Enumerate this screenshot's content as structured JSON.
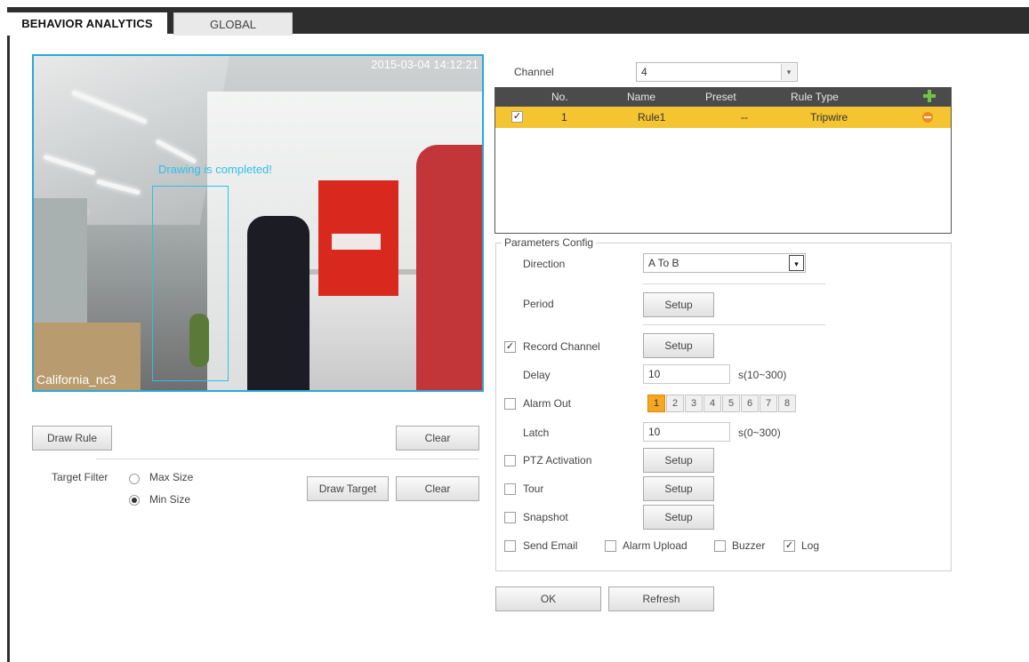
{
  "tabs": [
    {
      "label": "BEHAVIOR ANALYTICS",
      "active": true
    },
    {
      "label": "GLOBAL",
      "active": false
    }
  ],
  "video": {
    "timestamp": "2015-03-04 14:12:21",
    "overlay_text": "Drawing is completed!",
    "camera_name": "California_nc3"
  },
  "left_controls": {
    "draw_rule": "Draw Rule",
    "clear_rule": "Clear",
    "target_filter_label": "Target Filter",
    "max_size": "Max Size",
    "min_size": "Min Size",
    "selected_size": "Min Size",
    "draw_target": "Draw Target",
    "clear_target": "Clear"
  },
  "channel": {
    "label": "Channel",
    "value": "4"
  },
  "rules_table": {
    "headers": [
      "No.",
      "Name",
      "Preset",
      "Rule Type"
    ],
    "rows": [
      {
        "checked": true,
        "no": "1",
        "name": "Rule1",
        "preset": "--",
        "rule_type": "Tripwire"
      }
    ]
  },
  "params": {
    "legend": "Parameters Config",
    "direction_label": "Direction",
    "direction_value": "A To B",
    "period_label": "Period",
    "period_button": "Setup",
    "record_channel": {
      "label": "Record Channel",
      "checked": true,
      "button": "Setup"
    },
    "delay": {
      "label": "Delay",
      "value": "10",
      "range": "s(10~300)"
    },
    "alarm_out": {
      "label": "Alarm Out",
      "checked": false,
      "channels": [
        "1",
        "2",
        "3",
        "4",
        "5",
        "6",
        "7",
        "8"
      ],
      "selected": "1"
    },
    "latch": {
      "label": "Latch",
      "value": "10",
      "range": "s(0~300)"
    },
    "ptz": {
      "label": "PTZ Activation",
      "checked": false,
      "button": "Setup"
    },
    "tour": {
      "label": "Tour",
      "checked": false,
      "button": "Setup"
    },
    "snapshot": {
      "label": "Snapshot",
      "checked": false,
      "button": "Setup"
    },
    "send_email": {
      "label": "Send Email",
      "checked": false
    },
    "alarm_upload": {
      "label": "Alarm Upload",
      "checked": false
    },
    "buzzer": {
      "label": "Buzzer",
      "checked": false
    },
    "log": {
      "label": "Log",
      "checked": true
    }
  },
  "footer": {
    "ok": "OK",
    "refresh": "Refresh"
  },
  "colors": {
    "topbar": "#2e2e2e",
    "selected_row": "#f5c431",
    "video_border": "#2aa7d8",
    "overlay": "#2fc0e8"
  },
  "icons": {
    "add_rule": "plus-icon",
    "delete_rule": "minus-circle-icon",
    "dropdown": "chevron-down-icon"
  }
}
